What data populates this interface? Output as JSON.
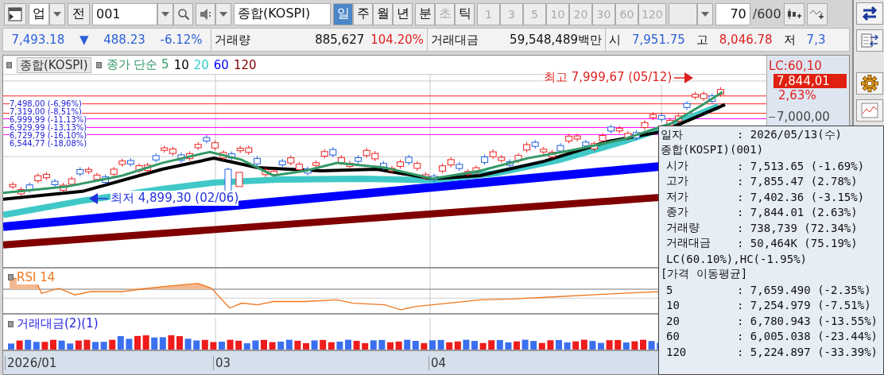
{
  "toolbar": {
    "market": "업",
    "prev_button": "전",
    "code": "001",
    "name": "종합(KOSPI)",
    "periods": [
      {
        "label": "일",
        "selected": true
      },
      {
        "label": "주",
        "selected": false
      },
      {
        "label": "월",
        "selected": false
      },
      {
        "label": "년",
        "selected": false
      }
    ],
    "intraday": [
      {
        "label": "분",
        "disabled": false
      },
      {
        "label": "초",
        "disabled": true
      },
      {
        "label": "틱",
        "disabled": false
      }
    ],
    "intervals": [
      {
        "label": "1",
        "disabled": true
      },
      {
        "label": "3",
        "disabled": true
      },
      {
        "label": "5",
        "disabled": true
      },
      {
        "label": "10",
        "disabled": true
      },
      {
        "label": "20",
        "disabled": true
      },
      {
        "label": "30",
        "disabled": true
      },
      {
        "label": "60",
        "disabled": true
      },
      {
        "label": "120",
        "disabled": true
      }
    ],
    "count": "70",
    "count_max": "/600"
  },
  "quote": {
    "price": "7,493.18",
    "direction": "▼",
    "change": "488.23",
    "change_rate": "-6.12%",
    "volume_label": "거래량",
    "volume": "885,627",
    "volume_rate": "104.20%",
    "amount_label": "거래대금",
    "amount": "59,548,489백만",
    "open_label": "시",
    "open": "7,951.75",
    "high_label": "고",
    "high": "8,046.78",
    "low_label": "저",
    "low": "7,3"
  },
  "chart": {
    "legend": {
      "series_name": "종합(KOSPI)",
      "ma": [
        {
          "label": "종가 단순 5",
          "color": "#339966"
        },
        {
          "label": "10",
          "color": "#000000"
        },
        {
          "label": "20",
          "color": "#33cccc"
        },
        {
          "label": "60",
          "color": "#0000ff"
        },
        {
          "label": "120",
          "color": "#800000"
        }
      ]
    },
    "price_levels": [
      "7,498,00 (-6,96%)",
      "7,319,00 (-8,51%)",
      "6,999,99 (-11,13%)",
      "6,929,99 (-13,13%)",
      "6,729,79 (-16,10%)",
      "6,544,77 (-18,08%)"
    ],
    "high_note": "최고 7,999,67 (05/12)",
    "low_note": "최저 4,899,30 (02/06)",
    "axis": {
      "lc": "LC:60,10",
      "last_price": "7,844,01",
      "last_rate": "2,63%",
      "tick": "7,000,00"
    }
  },
  "rsi": {
    "label": "RSI 14"
  },
  "amount_pane": {
    "label": "거래대금(2)(1)"
  },
  "dates": [
    "2026/01",
    "03",
    "04"
  ],
  "tooltip": {
    "lines": [
      {
        "kind": "pair",
        "label": "일자",
        "value": ": 2026/05/13(수)"
      },
      {
        "kind": "text",
        "text": "종합(KOSPI)(001)"
      },
      {
        "kind": "sub",
        "label": "시가",
        "value": ": 7,513.65 (-1.69%)"
      },
      {
        "kind": "sub",
        "label": "고가",
        "value": ": 7,855.47 (2.78%)"
      },
      {
        "kind": "sub",
        "label": "저가",
        "value": ": 7,402.36 (-3.15%)"
      },
      {
        "kind": "sub",
        "label": "종가",
        "value": ": 7,844.01 (2.63%)"
      },
      {
        "kind": "sub",
        "label": "거래량",
        "value": ": 738,739 (72.34%)"
      },
      {
        "kind": "sub",
        "label": "거래대금",
        "value": ": 50,464K (75.19%)"
      },
      {
        "kind": "subtext",
        "text": "LC(60.10%),HC(-1.95%)"
      },
      {
        "kind": "text",
        "text": "[가격 이동평균]"
      },
      {
        "kind": "sub",
        "label": "5",
        "value": ": 7,659.490 (-2.35%)"
      },
      {
        "kind": "sub",
        "label": "10",
        "value": ": 7,254.979 (-7.51%)"
      },
      {
        "kind": "sub",
        "label": "20",
        "value": ": 6,780.943 (-13.55%)"
      },
      {
        "kind": "sub",
        "label": "60",
        "value": ": 6,005.038 (-23.44%)"
      },
      {
        "kind": "sub",
        "label": "120",
        "value": ": 5,224.897 (-33.39%)"
      }
    ]
  }
}
